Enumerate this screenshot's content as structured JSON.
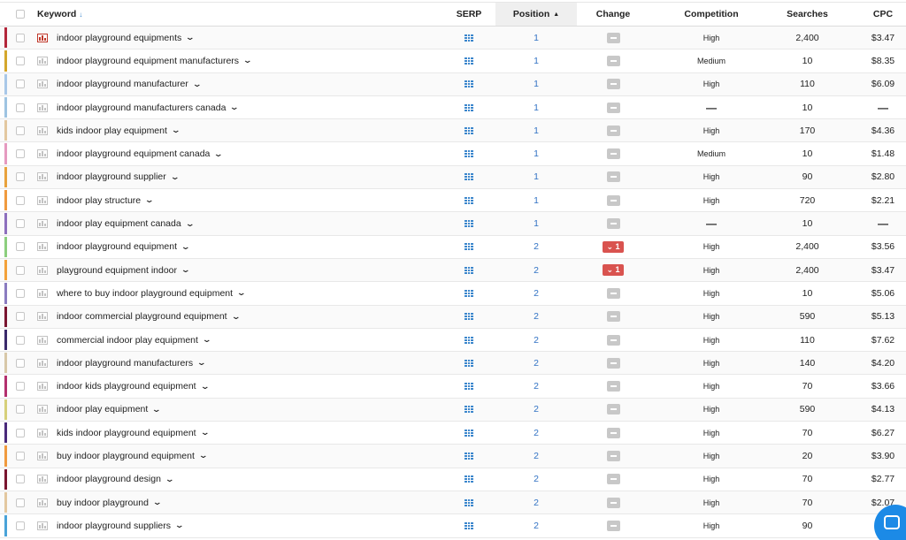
{
  "columns": {
    "keyword": "Keyword",
    "serp": "SERP",
    "position": "Position",
    "change": "Change",
    "competition": "Competition",
    "searches": "Searches",
    "cpc": "CPC"
  },
  "colors": {
    "position_link": "#3373c4",
    "serp_icon": "#3b86cc",
    "change_down": "#d9534f",
    "change_none": "#c8c8c8",
    "chat_button": "#1c8ae6"
  },
  "rows": [
    {
      "keyword": "indoor playground equipments",
      "position": "1",
      "change": "none",
      "competition": "High",
      "searches": "2,400",
      "cpc": "$3.47",
      "color": "#b3263a",
      "chart_active": true
    },
    {
      "keyword": "indoor playground equipment manufacturers",
      "position": "1",
      "change": "none",
      "competition": "Medium",
      "searches": "10",
      "cpc": "$8.35",
      "color": "#d4a72c",
      "chart_active": false
    },
    {
      "keyword": "indoor playground manufacturer",
      "position": "1",
      "change": "none",
      "competition": "High",
      "searches": "110",
      "cpc": "$6.09",
      "color": "#a9c8e8",
      "chart_active": false
    },
    {
      "keyword": "indoor playground manufacturers canada",
      "position": "1",
      "change": "none",
      "competition": "—",
      "searches": "10",
      "cpc": "—",
      "color": "#9ec4e2",
      "chart_active": false
    },
    {
      "keyword": "kids indoor play equipment",
      "position": "1",
      "change": "none",
      "competition": "High",
      "searches": "170",
      "cpc": "$4.36",
      "color": "#e3c8a0",
      "chart_active": false
    },
    {
      "keyword": "indoor playground equipment canada",
      "position": "1",
      "change": "none",
      "competition": "Medium",
      "searches": "10",
      "cpc": "$1.48",
      "color": "#e59ac0",
      "chart_active": false
    },
    {
      "keyword": "indoor playground supplier",
      "position": "1",
      "change": "none",
      "competition": "High",
      "searches": "90",
      "cpc": "$2.80",
      "color": "#e8a23c",
      "chart_active": false
    },
    {
      "keyword": "indoor play structure",
      "position": "1",
      "change": "none",
      "competition": "High",
      "searches": "720",
      "cpc": "$2.21",
      "color": "#f09a3e",
      "chart_active": false
    },
    {
      "keyword": "indoor play equipment canada",
      "position": "1",
      "change": "none",
      "competition": "—",
      "searches": "10",
      "cpc": "—",
      "color": "#8d6fbd",
      "chart_active": false
    },
    {
      "keyword": "indoor playground equipment",
      "position": "2",
      "change": "1",
      "competition": "High",
      "searches": "2,400",
      "cpc": "$3.56",
      "color": "#8ccf7e",
      "chart_active": false
    },
    {
      "keyword": "playground equipment indoor",
      "position": "2",
      "change": "1",
      "competition": "High",
      "searches": "2,400",
      "cpc": "$3.47",
      "color": "#f3a23a",
      "chart_active": false
    },
    {
      "keyword": "where to buy indoor playground equipment",
      "position": "2",
      "change": "none",
      "competition": "High",
      "searches": "10",
      "cpc": "$5.06",
      "color": "#8a7cc0",
      "chart_active": false
    },
    {
      "keyword": "indoor commercial playground equipment",
      "position": "2",
      "change": "none",
      "competition": "High",
      "searches": "590",
      "cpc": "$5.13",
      "color": "#7a1530",
      "chart_active": false
    },
    {
      "keyword": "commercial indoor play equipment",
      "position": "2",
      "change": "none",
      "competition": "High",
      "searches": "110",
      "cpc": "$7.62",
      "color": "#3a2a6b",
      "chart_active": false
    },
    {
      "keyword": "indoor playground manufacturers",
      "position": "2",
      "change": "none",
      "competition": "High",
      "searches": "140",
      "cpc": "$4.20",
      "color": "#d8c8a8",
      "chart_active": false
    },
    {
      "keyword": "indoor kids playground equipment",
      "position": "2",
      "change": "none",
      "competition": "High",
      "searches": "70",
      "cpc": "$3.66",
      "color": "#b3306e",
      "chart_active": false
    },
    {
      "keyword": "indoor play equipment",
      "position": "2",
      "change": "none",
      "competition": "High",
      "searches": "590",
      "cpc": "$4.13",
      "color": "#d6d07a",
      "chart_active": false
    },
    {
      "keyword": "kids indoor playground equipment",
      "position": "2",
      "change": "none",
      "competition": "High",
      "searches": "70",
      "cpc": "$6.27",
      "color": "#4a2a7a",
      "chart_active": false
    },
    {
      "keyword": "buy indoor playground equipment",
      "position": "2",
      "change": "none",
      "competition": "High",
      "searches": "20",
      "cpc": "$3.90",
      "color": "#f09a3e",
      "chart_active": false
    },
    {
      "keyword": "indoor playground design",
      "position": "2",
      "change": "none",
      "competition": "High",
      "searches": "70",
      "cpc": "$2.77",
      "color": "#7a1530",
      "chart_active": false
    },
    {
      "keyword": "buy indoor playground",
      "position": "2",
      "change": "none",
      "competition": "High",
      "searches": "70",
      "cpc": "$2.07",
      "color": "#e3c8a0",
      "chart_active": false
    },
    {
      "keyword": "indoor playground suppliers",
      "position": "2",
      "change": "none",
      "competition": "High",
      "searches": "90",
      "cpc": "",
      "color": "#4aa3d8",
      "chart_active": false
    }
  ]
}
